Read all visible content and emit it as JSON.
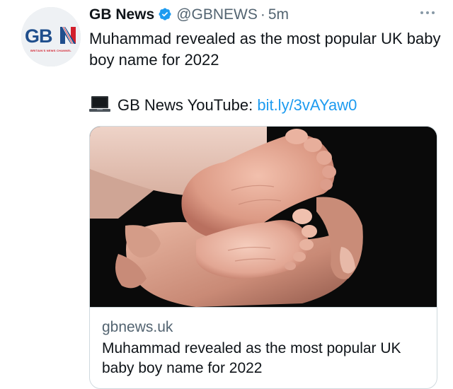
{
  "author": {
    "name": "GB News",
    "handle": "@GBNEWS",
    "separator": "·",
    "time": "5m",
    "avatar_logo_text": "GBN",
    "avatar_tagline": "BRITAIN'S NEWS CHANNEL"
  },
  "tweet": {
    "text": "Muhammad revealed as the most popular UK baby boy name for 2022",
    "youtube_label": "GB News YouTube:",
    "youtube_link": "bit.ly/3vAYaw0"
  },
  "card": {
    "domain": "gbnews.uk",
    "title": "Muhammad revealed as the most popular UK baby boy name for 2022"
  },
  "icons": {
    "verified": "verified-badge-icon",
    "laptop": "laptop-icon",
    "more": "more-options-icon"
  },
  "colors": {
    "link": "#1d9bf0",
    "verified": "#1d9bf0",
    "secondary_text": "#536471",
    "logo_blue": "#1f4e8c",
    "logo_red": "#d21f2c"
  }
}
